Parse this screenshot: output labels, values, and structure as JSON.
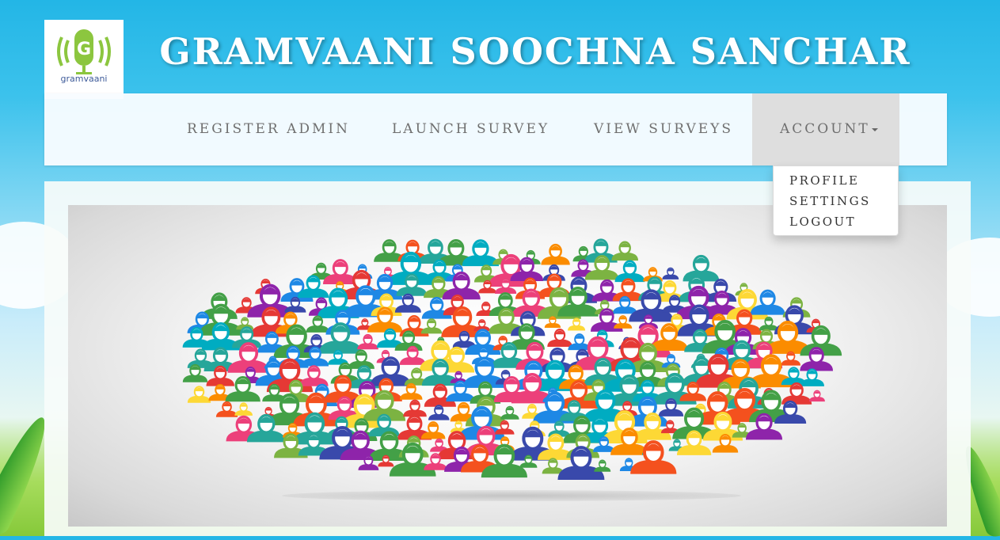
{
  "brand": {
    "logo_text": "gramvaani",
    "site_title": "GRAMVAANI SOOCHNA SANCHAR"
  },
  "nav": {
    "register_admin": "REGISTER ADMIN",
    "launch_survey": "LAUNCH SURVEY",
    "view_surveys": "VIEW SURVEYS",
    "account": "ACCOUNT"
  },
  "account_menu": {
    "profile": "PROFILE",
    "settings": "SETTINGS",
    "logout": "LOGOUT"
  },
  "hero": {
    "icon": "people-avatars-cloud-icon",
    "palette": [
      "#e53935",
      "#1e88e5",
      "#43a047",
      "#fb8c00",
      "#8e24aa",
      "#00acc1",
      "#fdd835",
      "#ec407a",
      "#3949ab",
      "#26a69a",
      "#f4511e",
      "#7cb342"
    ]
  },
  "colors": {
    "sky": "#23b6e6",
    "nav_text": "#6f6f6f",
    "active_tab": "#dedede",
    "title_text": "#ffffff"
  }
}
